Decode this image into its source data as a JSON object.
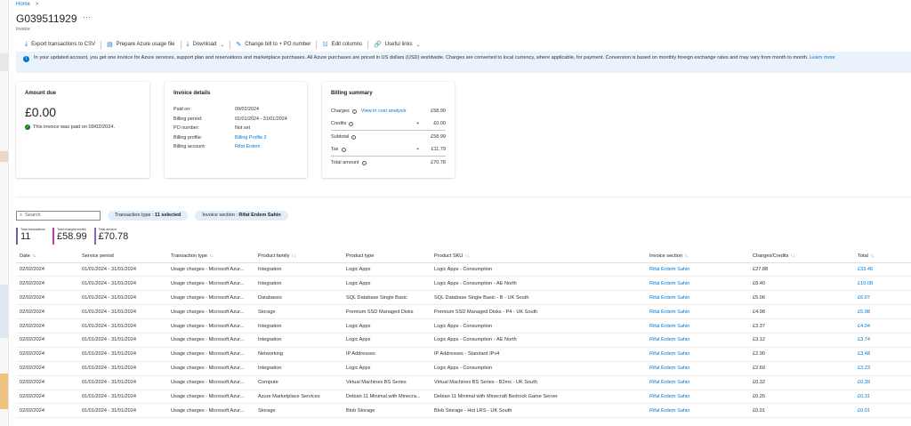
{
  "breadcrumb": {
    "home": "Home",
    "sep": ">"
  },
  "header": {
    "title": "G039511929",
    "more": "···",
    "subtitle": "Invoice"
  },
  "toolbar": {
    "items": [
      {
        "icon": "download-icon",
        "label": "Export transactions to CSV"
      },
      {
        "icon": "document-icon",
        "label": "Prepare Azure usage file"
      },
      {
        "icon": "download-icon",
        "label": "Download"
      },
      {
        "icon": "edit-icon",
        "label": "Change bill to + PO number"
      },
      {
        "icon": "columns-icon",
        "label": "Edit columns"
      },
      {
        "icon": "link-icon",
        "label": "Useful links"
      }
    ]
  },
  "banner": {
    "text": "In your updated account, you get one invoice for Azure services, support plan and reservations and marketplace purchases. All Azure purchases are priced in US dollars (USD) worldwide. Charges are converted to local currency, where applicable, for payment. Conversion is based on monthly foreign exchange rates and may vary from month to month.",
    "link": "Learn more"
  },
  "amount_due": {
    "title": "Amount due",
    "amount": "£0.00",
    "note": "This invoice was paid on 09/02/2024."
  },
  "invoice_details": {
    "title": "Invoice details",
    "rows": [
      {
        "k": "Paid on:",
        "v": "09/02/2024"
      },
      {
        "k": "Billing period:",
        "v": "01/01/2024 - 31/01/2024"
      },
      {
        "k": "PO number:",
        "v": "Not set"
      },
      {
        "k": "Billing profile:",
        "v": "Billing Profile 2"
      },
      {
        "k": "Billing account:",
        "v": "Rifat Erdem"
      }
    ]
  },
  "billing_summary": {
    "title": "Billing summary",
    "charges_label": "Charges",
    "cost_link": "View in cost analysis",
    "charges": "£58.99",
    "credits_label": "Credits",
    "credits_sign": "+",
    "credits": "£0.00",
    "subtotal_label": "Subtotal",
    "subtotal": "£58.99",
    "tax_label": "Tax",
    "tax_sign": "+",
    "tax": "£11.79",
    "total_label": "Total amount",
    "total": "£70.78"
  },
  "filters": {
    "search_placeholder": "Search",
    "pill1_label": "Transaction type : ",
    "pill1_value": "11 selected",
    "pill2_label": "Invoice section : ",
    "pill2_value": "Rifat Erdem Sahin"
  },
  "stats": [
    {
      "label": "Total transactions",
      "value": "11",
      "color": "#6264a7"
    },
    {
      "label": "Total charges/credits",
      "value": "£58.99",
      "color": "#c239b3"
    },
    {
      "label": "Total amount",
      "value": "£70.78",
      "color": "#8764b8"
    }
  ],
  "table": {
    "headers": [
      "Date",
      "Service period",
      "Transaction type",
      "Product family",
      "Product type",
      "Product SKU",
      "Invoice section",
      "Charges/Credits",
      "Total"
    ],
    "rows": [
      [
        "02/02/2024",
        "01/01/2024 - 31/01/2024",
        "Usage charges - Microsoft Azur...",
        "Integration",
        "Logic Apps",
        "Logic Apps - Consumption",
        "Rifat Erdem Sahin",
        "£27.88",
        "£33.46"
      ],
      [
        "02/02/2024",
        "01/01/2024 - 31/01/2024",
        "Usage charges - Microsoft Azur...",
        "Integration",
        "Logic Apps",
        "Logic Apps - Consumption - AE North",
        "Rifat Erdem Sahin",
        "£8.40",
        "£10.08"
      ],
      [
        "02/02/2024",
        "01/01/2024 - 31/01/2024",
        "Usage charges - Microsoft Azur...",
        "Databases",
        "SQL Database Single Basic",
        "SQL Database Single Basic - B - UK South",
        "Rifat Erdem Sahin",
        "£5.06",
        "£6.07"
      ],
      [
        "02/02/2024",
        "01/01/2024 - 31/01/2024",
        "Usage charges - Microsoft Azur...",
        "Storage",
        "Premium SSD Managed Disks",
        "Premium SSD Managed Disks - P4 - UK South",
        "Rifat Erdem Sahin",
        "£4.98",
        "£5.98"
      ],
      [
        "02/02/2024",
        "01/01/2024 - 31/01/2024",
        "Usage charges - Microsoft Azur...",
        "Integration",
        "Logic Apps",
        "Logic Apps - Consumption",
        "Rifat Erdem Sahin",
        "£3.37",
        "£4.04"
      ],
      [
        "02/02/2024",
        "01/01/2024 - 31/01/2024",
        "Usage charges - Microsoft Azur...",
        "Integration",
        "Logic Apps",
        "Logic Apps - Consumption - AE North",
        "Rifat Erdem Sahin",
        "£3.12",
        "£3.74"
      ],
      [
        "02/02/2024",
        "01/01/2024 - 31/01/2024",
        "Usage charges - Microsoft Azur...",
        "Networking",
        "IP Addresses",
        "IP Addresses - Standard IPv4",
        "Rifat Erdem Sahin",
        "£2.90",
        "£3.48"
      ],
      [
        "02/02/2024",
        "01/01/2024 - 31/01/2024",
        "Usage charges - Microsoft Azur...",
        "Integration",
        "Logic Apps",
        "Logic Apps - Consumption",
        "Rifat Erdem Sahin",
        "£2.69",
        "£3.23"
      ],
      [
        "02/02/2024",
        "01/01/2024 - 31/01/2024",
        "Usage charges - Microsoft Azur...",
        "Compute",
        "Virtual Machines BS Series",
        "Virtual Machines BS Series - B2ms - UK South",
        "Rifat Erdem Sahin",
        "£0.32",
        "£0.39"
      ],
      [
        "02/02/2024",
        "01/01/2024 - 31/01/2024",
        "Usage charges - Microsoft Azur...",
        "Azure Marketplace Services",
        "Debian 11 Minimal with Minecra...",
        "Debian 11 Minimal with Minecraft Bedrock Game Server",
        "Rifat Erdem Sahin",
        "£0.26",
        "£0.31"
      ],
      [
        "02/02/2024",
        "01/01/2024 - 31/01/2024",
        "Usage charges - Microsoft Azur...",
        "Storage",
        "Blob Storage",
        "Blob Storage - Hot LRS - UK South",
        "Rifat Erdem Sahin",
        "£0.01",
        "£0.01"
      ]
    ]
  }
}
